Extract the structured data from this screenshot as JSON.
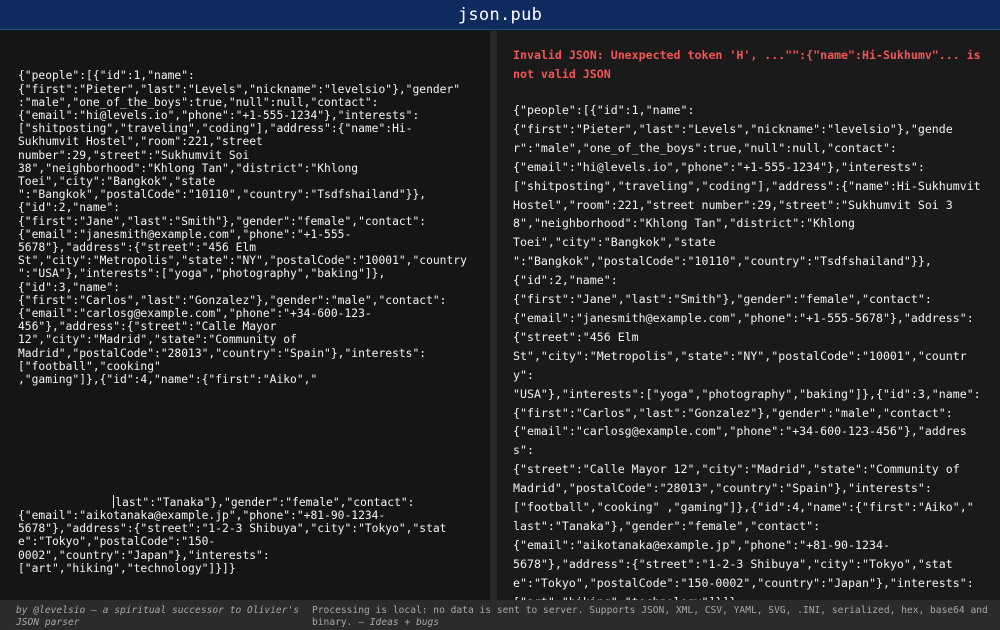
{
  "app": {
    "title": "json.pub"
  },
  "editor": {
    "part1": "{\"people\":[{\"id\":1,\"name\":\n{\"first\":\"Pieter\",\"last\":\"Levels\",\"nickname\":\"levelsio\"},\"gender\"\n:\"male\",\"one_of_the_boys\":true,\"null\":null,\"contact\":\n{\"email\":\"hi@levels.io\",\"phone\":\"+1-555-1234\"},\"interests\":\n[\"shitposting\",\"traveling\",\"coding\"],\"address\":{\"name\":Hi-\nSukhumvit Hostel\",\"room\":221,\"street\nnumber\":29,\"street\":\"Sukhumvit Soi\n38\",\"neighborhood\":\"Khlong Tan\",\"district\":\"Khlong\nToei\",\"city\":\"Bangkok\",\"state\n\":\"Bangkok\",\"postalCode\":\"10110\",\"country\":\"Tsdfshailand\"}},\n{\"id\":2,\"name\":\n{\"first\":\"Jane\",\"last\":\"Smith\"},\"gender\":\"female\",\"contact\":\n{\"email\":\"janesmith@example.com\",\"phone\":\"+1-555-\n5678\"},\"address\":{\"street\":\"456 Elm\nSt\",\"city\":\"Metropolis\",\"state\":\"NY\",\"postalCode\":\"10001\",\"country\n\":\"USA\"},\"interests\":[\"yoga\",\"photography\",\"baking\"]},\n{\"id\":3,\"name\":\n{\"first\":\"Carlos\",\"last\":\"Gonzalez\"},\"gender\":\"male\",\"contact\":\n{\"email\":\"carlosg@example.com\",\"phone\":\"+34-600-123-\n456\"},\"address\":{\"street\":\"Calle Mayor\n12\",\"city\":\"Madrid\",\"state\":\"Community of\nMadrid\",\"postalCode\":\"28013\",\"country\":\"Spain\"},\"interests\":\n[\"football\",\"cooking\"\n,\"gaming\"]},{\"id\":4,\"name\":{\"first\":\"Aiko\",\"",
    "part2_indent": "              ",
    "part2": "last\":\"Tanaka\"},\"gender\":\"female\",\"contact\":\n{\"email\":\"aikotanaka@example.jp\",\"phone\":\"+81-90-1234-\n5678\"},\"address\":{\"street\":\"1-2-3 Shibuya\",\"city\":\"Tokyo\",\"stat\ne\":\"Tokyo\",\"postalCode\":\"150-\n0002\",\"country\":\"Japan\"},\"interests\":\n[\"art\",\"hiking\",\"technology\"]}]}"
  },
  "output": {
    "error": "Invalid JSON: Unexpected token 'H', ...\"\":{\"name\":Hi-Sukhumv\"... is not valid JSON",
    "json": "{\"people\":[{\"id\":1,\"name\":\n{\"first\":\"Pieter\",\"last\":\"Levels\",\"nickname\":\"levelsio\"},\"gender\":\"male\",\"one_of_the_boys\":true,\"null\":null,\"contact\":\n{\"email\":\"hi@levels.io\",\"phone\":\"+1-555-1234\"},\"interests\":\n[\"shitposting\",\"traveling\",\"coding\"],\"address\":{\"name\":Hi-Sukhumvit Hostel\",\"room\":221,\"street number\":29,\"street\":\"Sukhumvit Soi 38\",\"neighborhood\":\"Khlong Tan\",\"district\":\"Khlong\nToei\",\"city\":\"Bangkok\",\"state\n\":\"Bangkok\",\"postalCode\":\"10110\",\"country\":\"Tsdfshailand\"}},\n{\"id\":2,\"name\":\n{\"first\":\"Jane\",\"last\":\"Smith\"},\"gender\":\"female\",\"contact\":\n{\"email\":\"janesmith@example.com\",\"phone\":\"+1-555-5678\"},\"address\":\n{\"street\":\"456 Elm\nSt\",\"city\":\"Metropolis\",\"state\":\"NY\",\"postalCode\":\"10001\",\"country\":\n\"USA\"},\"interests\":[\"yoga\",\"photography\",\"baking\"]},{\"id\":3,\"name\":\n{\"first\":\"Carlos\",\"last\":\"Gonzalez\"},\"gender\":\"male\",\"contact\":\n{\"email\":\"carlosg@example.com\",\"phone\":\"+34-600-123-456\"},\"address\":\n{\"street\":\"Calle Mayor 12\",\"city\":\"Madrid\",\"state\":\"Community of\nMadrid\",\"postalCode\":\"28013\",\"country\":\"Spain\"},\"interests\":\n[\"football\",\"cooking\" ,\"gaming\"]},{\"id\":4,\"name\":{\"first\":\"Aiko\",\"\nlast\":\"Tanaka\"},\"gender\":\"female\",\"contact\":\n{\"email\":\"aikotanaka@example.jp\",\"phone\":\"+81-90-1234-\n5678\"},\"address\":{\"street\":\"1-2-3 Shibuya\",\"city\":\"Tokyo\",\"stat\ne\":\"Tokyo\",\"postalCode\":\"150-0002\",\"country\":\"Japan\"},\"interests\":\n[\"art\",\"hiking\",\"technology\"]}]}"
  },
  "footer": {
    "credit_prefix": "by ",
    "credit_author": "@levelsio",
    "credit_middle": " — a spiritual successor to ",
    "credit_link": "Olivier's JSON parser",
    "info_text": "Processing is local: no data is sent to server. Supports JSON, XML, CSV, YAML, SVG, .INI, serialized, hex, base64 and binary. — ",
    "info_link": "Ideas + bugs"
  },
  "colors": {
    "titlebar": "#0e2a5e",
    "error": "#f25555",
    "background": "#151515"
  }
}
